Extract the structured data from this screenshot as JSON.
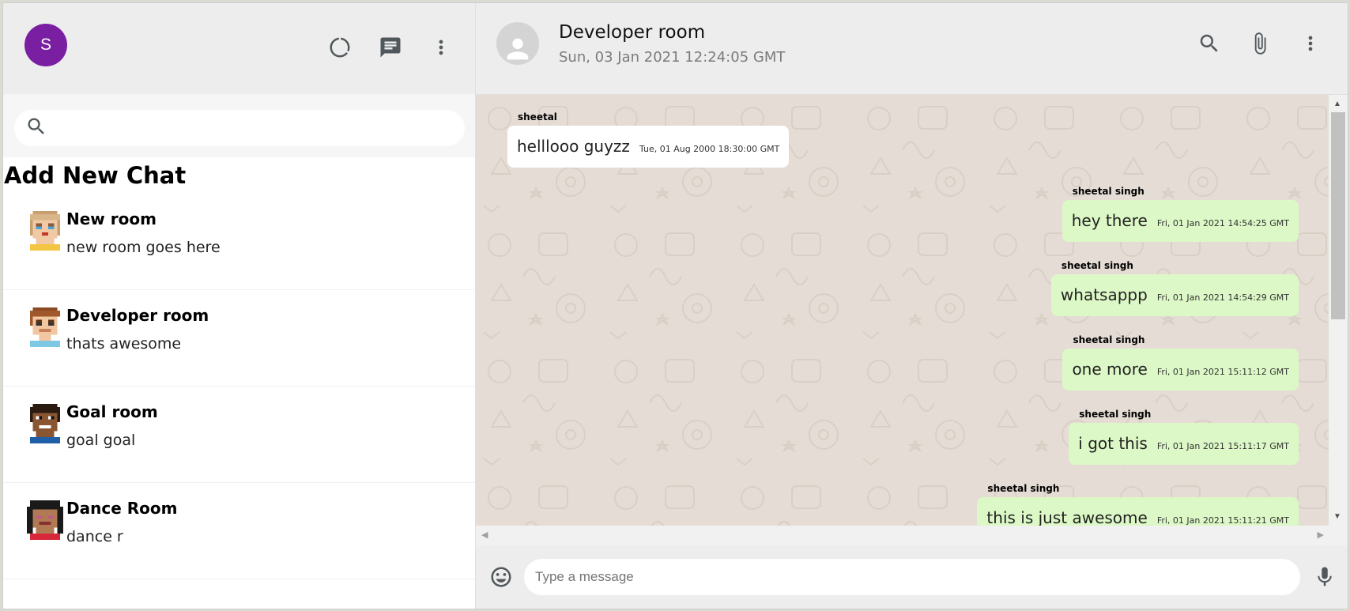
{
  "user": {
    "initial": "S",
    "avatar_color": "#7b1fa2"
  },
  "sidebar": {
    "search_placeholder": "",
    "add_chat_label": "Add New Chat",
    "rooms": [
      {
        "name": "New room",
        "last_message": "new room goes here",
        "avatar": "pixel-avatar-blonde"
      },
      {
        "name": "Developer room",
        "last_message": "thats awesome",
        "avatar": "pixel-avatar-brown-hair"
      },
      {
        "name": "Goal room",
        "last_message": "goal goal",
        "avatar": "pixel-avatar-dark-skin"
      },
      {
        "name": "Dance Room",
        "last_message": "dance r",
        "avatar": "pixel-avatar-black-hair"
      }
    ]
  },
  "chat": {
    "room_name": "Developer room",
    "last_seen": "Sun, 03 Jan 2021 12:24:05 GMT",
    "messages": [
      {
        "sender": "sheetal",
        "text": "helllooo guyzz",
        "time": "Tue, 01 Aug 2000 18:30:00 GMT",
        "type": "received"
      },
      {
        "sender": "sheetal singh",
        "text": "hey there",
        "time": "Fri, 01 Jan 2021 14:54:25 GMT",
        "type": "sent"
      },
      {
        "sender": "sheetal singh",
        "text": "whatsappp",
        "time": "Fri, 01 Jan 2021 14:54:29 GMT",
        "type": "sent"
      },
      {
        "sender": "sheetal singh",
        "text": "one more",
        "time": "Fri, 01 Jan 2021 15:11:12 GMT",
        "type": "sent"
      },
      {
        "sender": "sheetal singh",
        "text": "i got this",
        "time": "Fri, 01 Jan 2021 15:11:17 GMT",
        "type": "sent"
      },
      {
        "sender": "sheetal singh",
        "text": "this is just awesome",
        "time": "Fri, 01 Jan 2021 15:11:21 GMT",
        "type": "sent"
      }
    ],
    "input_placeholder": "Type a message"
  },
  "colors": {
    "sent_bubble": "#dcf8c6",
    "received_bubble": "#ffffff",
    "chat_bg": "#e5ddd5",
    "header_bg": "#ededed"
  }
}
